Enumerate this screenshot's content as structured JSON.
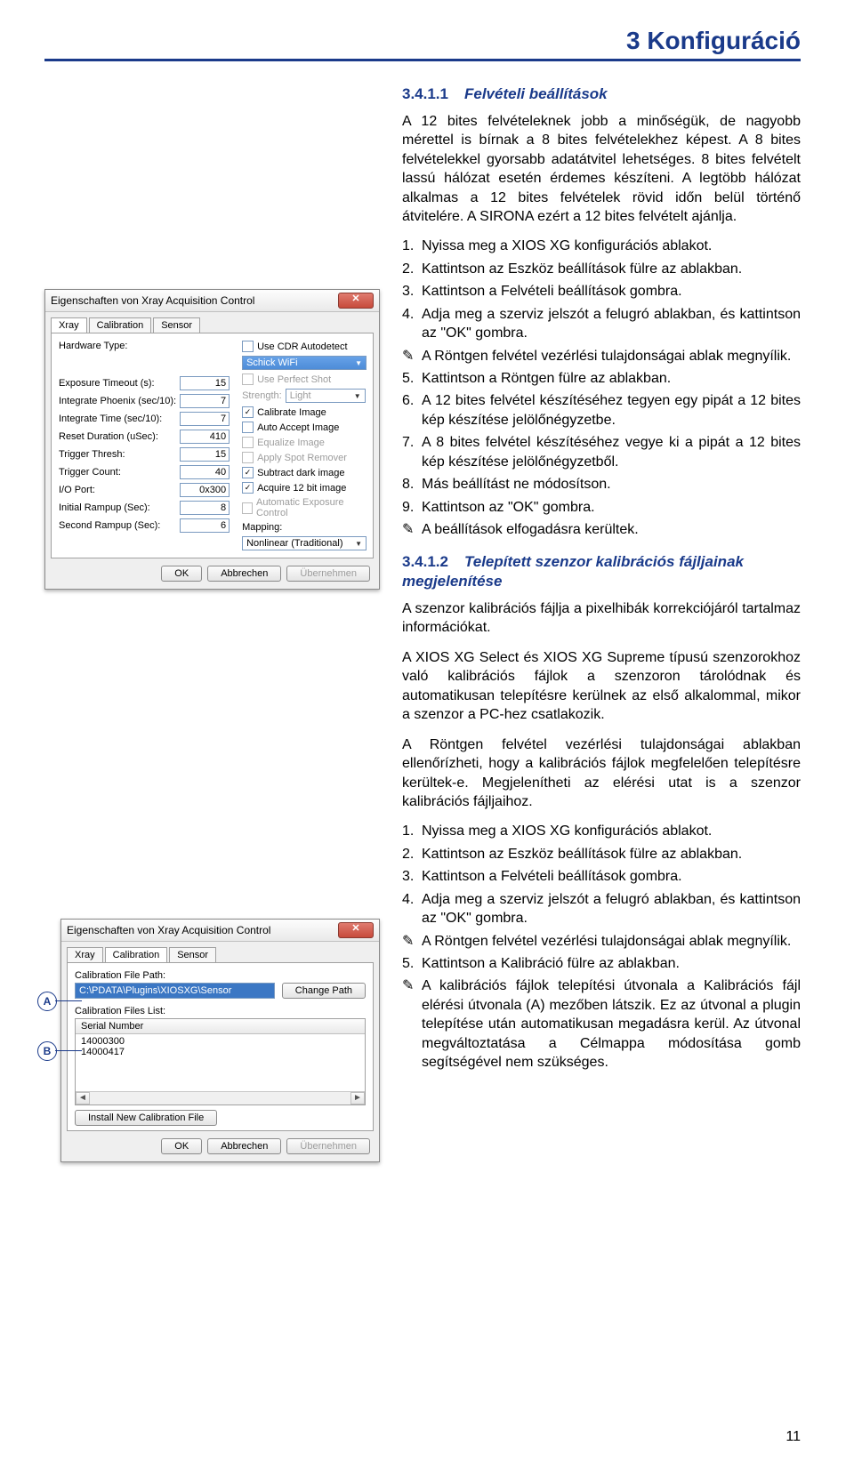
{
  "chapter": "3 Konfiguráció",
  "s1": {
    "num": "3.4.1.1",
    "title": "Felvételi beállítások"
  },
  "intro": "A 12 bites felvételeknek jobb a minőségük, de nagyobb mérettel is bírnak a 8 bites felvételekhez képest. A 8 bites felvételekkel gyorsabb adatátvitel lehetséges. 8 bites felvételt lassú hálózat esetén érdemes készíteni. A legtöbb hálózat alkalmas a 12 bites felvételek rövid időn belül történő átvitelére. A SIRONA ezért a 12 bites felvételt ajánlja.",
  "steps1": {
    "s1": "Nyissa meg a XIOS XG konfigurációs ablakot.",
    "s2": "Kattintson az Eszköz beállítások fülre az ablakban.",
    "s3": "Kattintson a Felvételi beállítások gombra.",
    "s4": "Adja meg a szerviz jelszót a felugró ablakban, és kattintson az \"OK\" gombra.",
    "r4": "A Röntgen felvétel vezérlési tulajdonságai ablak megnyílik.",
    "s5": "Kattintson a Röntgen fülre az ablakban.",
    "s6": "A 12 bites felvétel készítéséhez tegyen egy pipát a 12 bites kép készítése jelölőnégyzetbe.",
    "s7": "A 8 bites felvétel készítéséhez vegye ki a pipát a 12 bites kép készítése jelölőnégyzetből.",
    "s8": "Más beállítást ne módosítson.",
    "s9": "Kattintson az \"OK\" gombra.",
    "r9": "A beállítások elfogadásra kerültek."
  },
  "s2": {
    "num": "3.4.1.2",
    "title": "Telepített szenzor kalibrációs fájljainak megjelenítése"
  },
  "p2a": "A szenzor kalibrációs fájlja a pixelhibák korrekciójáról tartalmaz információkat.",
  "p2b": "A XIOS XG Select és XIOS XG Supreme típusú szenzorokhoz való kalibrációs fájlok a szenzoron tárolódnak és automatikusan telepítésre kerülnek az első alkalommal, mikor a szenzor a PC-hez csatlakozik.",
  "p2c": "A Röntgen felvétel vezérlési tulajdonságai ablakban ellenőrízheti, hogy a kalibrációs fájlok megfelelően telepítésre kerültek-e. Megjelenítheti az elérési utat is a szenzor kalibrációs fájljaihoz.",
  "steps2": {
    "s1": "Nyissa meg a XIOS XG konfigurációs ablakot.",
    "s2": "Kattintson az Eszköz beállítások fülre az ablakban.",
    "s3": "Kattintson a Felvételi beállítások gombra.",
    "s4": "Adja meg a szerviz jelszót a felugró ablakban, és kattintson az \"OK\" gombra.",
    "r4": "A Röntgen felvétel vezérlési tulajdonságai ablak megnyílik.",
    "s5": "Kattintson a Kalibráció fülre az ablakban.",
    "r5": "A kalibrációs fájlok telepítési útvonala a Kalibrációs fájl elérési útvonala (A) mezőben látszik. Ez az útvonal a plugin telepítése után automatikusan megadásra kerül. Az útvonal megváltoztatása a Célmappa módosítása gomb segítségével nem szükséges."
  },
  "dlg1": {
    "title": "Eigenschaften von Xray Acquisition Control",
    "tabs": {
      "xray": "Xray",
      "calibration": "Calibration",
      "sensor": "Sensor"
    },
    "left": {
      "hw": "Hardware Type:",
      "exp": "Exposure Timeout (s):",
      "exp_v": "15",
      "iph": "Integrate Phoenix (sec/10):",
      "iph_v": "7",
      "itm": "Integrate Time (sec/10):",
      "itm_v": "7",
      "res": "Reset Duration (uSec):",
      "res_v": "410",
      "trg": "Trigger Thresh:",
      "trg_v": "15",
      "cnt": "Trigger Count:",
      "cnt_v": "40",
      "io": "I/O Port:",
      "io_v": "0x300",
      "ir": "Initial Rampup (Sec):",
      "ir_v": "8",
      "sr": "Second Rampup (Sec):",
      "sr_v": "6"
    },
    "right": {
      "autodetect": "Use CDR Autodetect",
      "device": "Schick WiFi",
      "perfect": "Use Perfect Shot",
      "strength": "Strength:",
      "strength_v": "Light",
      "calibrate": "Calibrate Image",
      "autoaccept": "Auto Accept Image",
      "equalize": "Equalize Image",
      "spot": "Apply Spot Remover",
      "subtract": "Subtract dark image",
      "acq12": "Acquire 12 bit image",
      "autoexp": "Automatic Exposure Control",
      "mapping": "Mapping:",
      "mapping_v": "Nonlinear (Traditional)"
    },
    "btns": {
      "ok": "OK",
      "cancel": "Abbrechen",
      "apply": "Übernehmen"
    }
  },
  "dlg2": {
    "title": "Eigenschaften von Xray Acquisition Control",
    "tabs": {
      "xray": "Xray",
      "calibration": "Calibration",
      "sensor": "Sensor"
    },
    "label_path": "Calibration File Path:",
    "path": "C:\\PDATA\\Plugins\\XIOSXG\\Sensor",
    "change": "Change Path",
    "label_list": "Calibration Files List:",
    "colhead": "Serial Number",
    "rows": [
      "14000300",
      "14000417"
    ],
    "install": "Install New Calibration File",
    "btns": {
      "ok": "OK",
      "cancel": "Abbrechen",
      "apply": "Übernehmen"
    }
  },
  "annots": {
    "a": "A",
    "b": "B"
  },
  "pageno": "11"
}
